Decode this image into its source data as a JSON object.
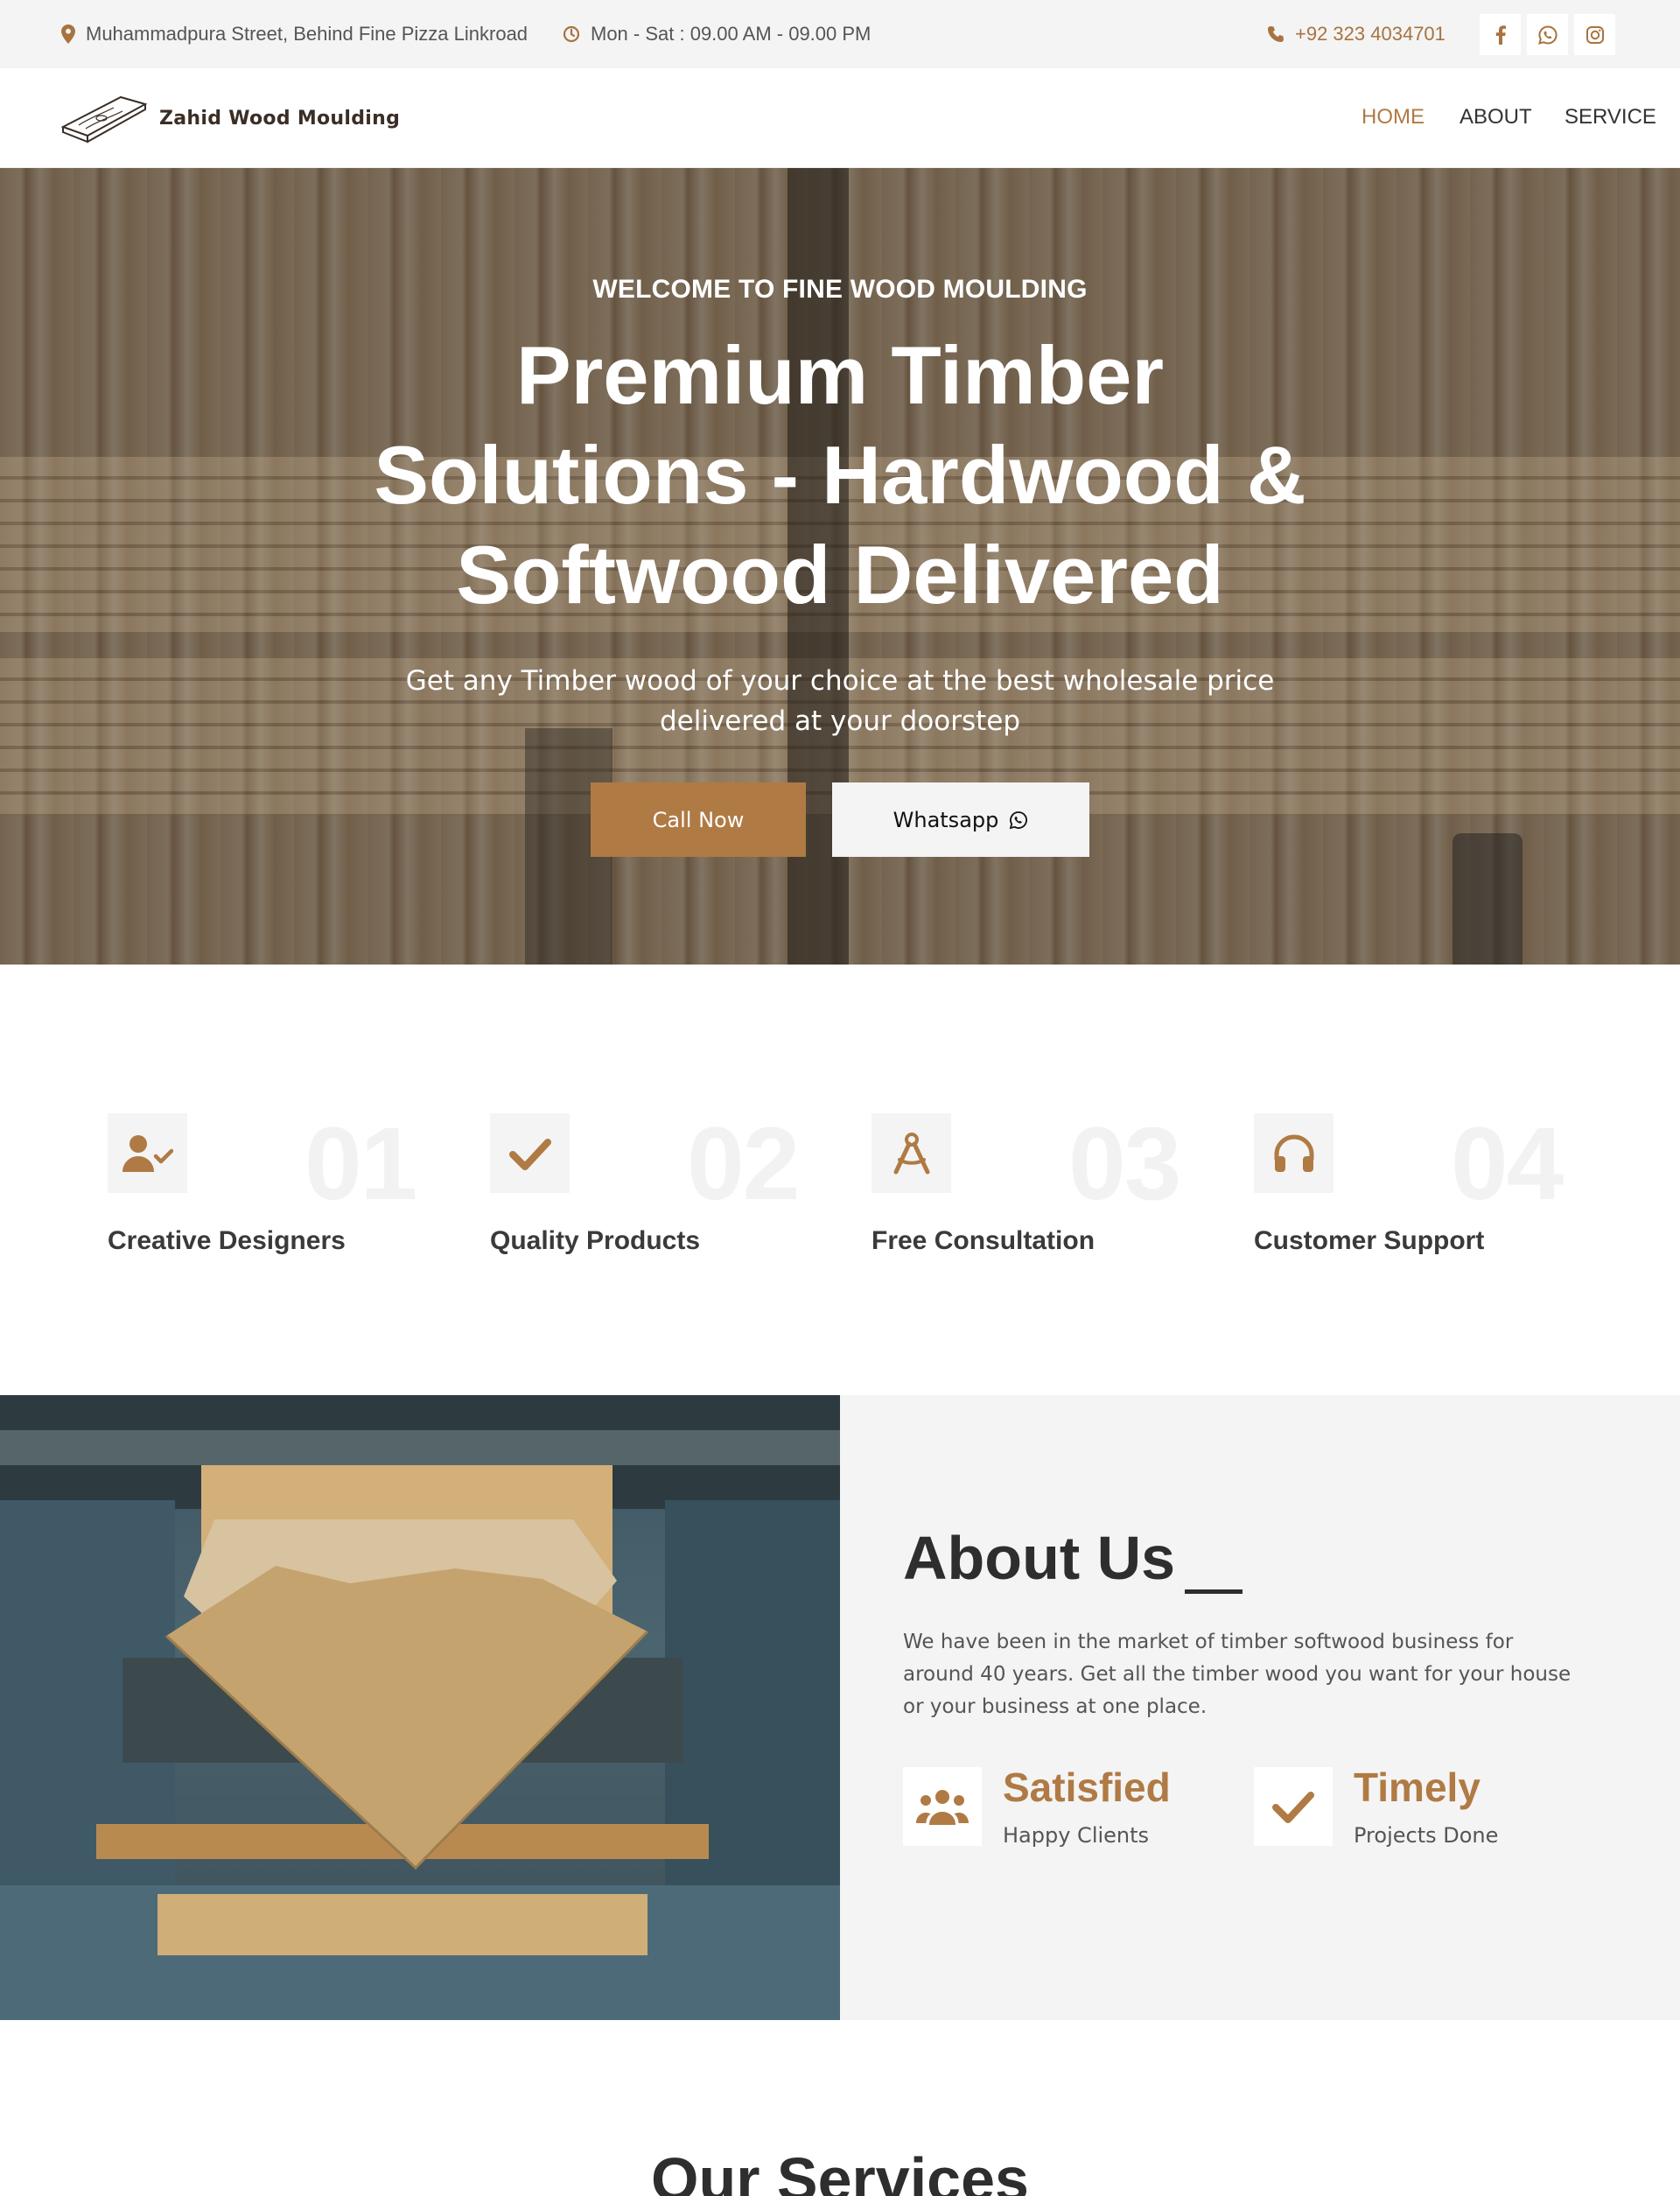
{
  "topbar": {
    "address": "Muhammadpura Street, Behind Fine Pizza Linkroad",
    "hours": "Mon - Sat : 09.00 AM - 09.00 PM",
    "phone": "+92 323 4034701",
    "social": [
      "facebook-icon",
      "whatsapp-icon",
      "instagram-icon"
    ]
  },
  "nav": {
    "logo_text": "Zahid Wood Moulding",
    "links": [
      "HOME",
      "ABOUT",
      "SERVICE"
    ],
    "active": "HOME"
  },
  "hero": {
    "kicker": "WELCOME TO FINE WOOD MOULDING",
    "title": "Premium Timber Solutions - Hardwood & Softwood Delivered",
    "subtitle": "Get any Timber wood of your choice at the best wholesale price delivered at your doorstep",
    "call_label": "Call Now",
    "whatsapp_label": "Whatsapp"
  },
  "features": [
    {
      "number": "01",
      "title": "Creative Designers",
      "icon": "user-check-icon"
    },
    {
      "number": "02",
      "title": "Quality Products",
      "icon": "check-icon"
    },
    {
      "number": "03",
      "title": "Free Consultation",
      "icon": "compass-drafting-icon"
    },
    {
      "number": "04",
      "title": "Customer Support",
      "icon": "headphones-icon"
    }
  ],
  "about": {
    "title": "About Us",
    "text": "We have been in the market of timber softwood business for around 40 years. Get all the timber wood you want for your house or your business at one place.",
    "stats": [
      {
        "title": "Satisfied",
        "subtitle": "Happy Clients",
        "icon": "users-icon"
      },
      {
        "title": "Timely",
        "subtitle": "Projects Done",
        "icon": "check-icon"
      }
    ]
  },
  "services": {
    "title": "Our Services"
  },
  "colors": {
    "accent": "#b07a44",
    "topbar_bg": "#f4f4f4",
    "dark_text": "#2e2e2e"
  }
}
